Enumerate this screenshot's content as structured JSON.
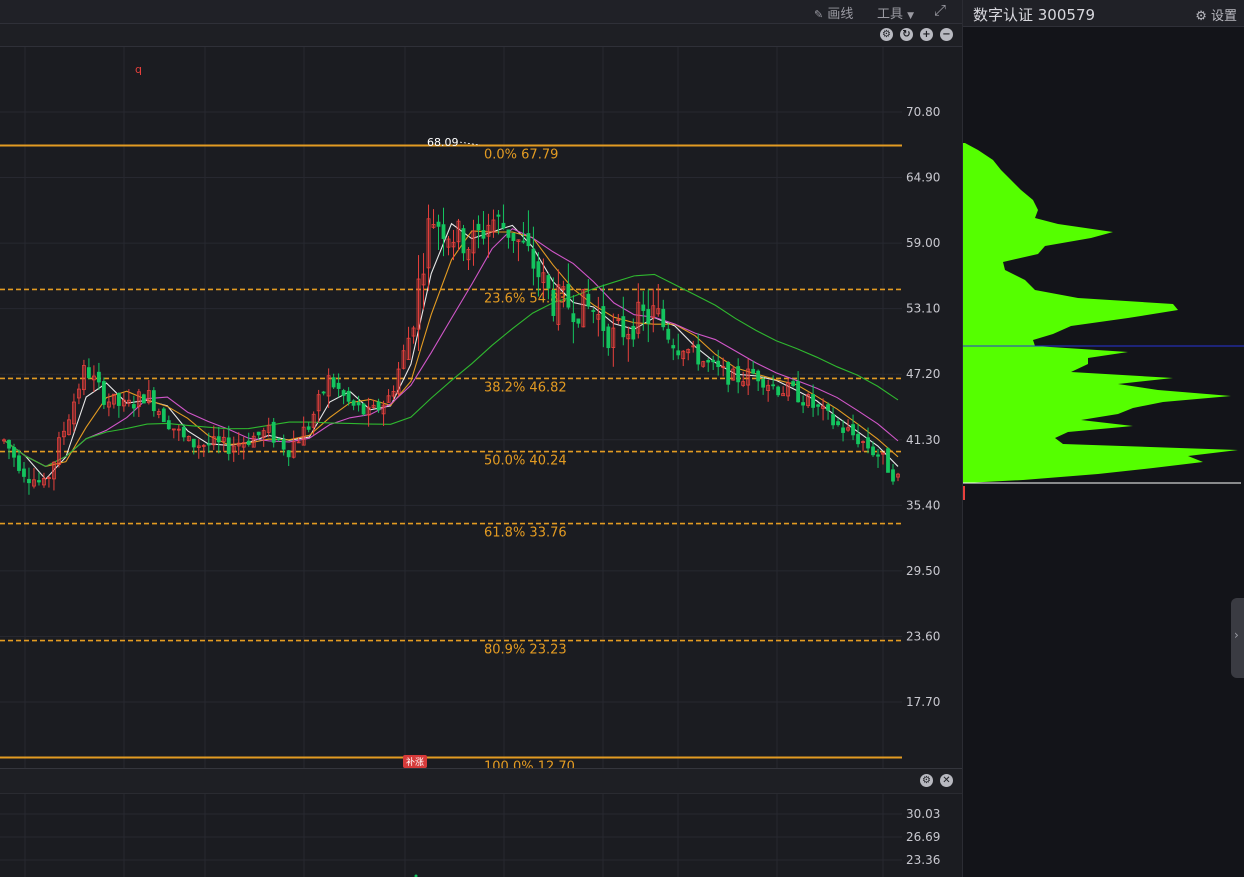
{
  "toolbar": {
    "draw_label": "画线",
    "tools_label": "工具",
    "chart_icons": [
      "gear-icon",
      "refresh-icon",
      "zoom-in-icon",
      "zoom-out-icon"
    ],
    "marker_q": "q",
    "event_badge": "补涨"
  },
  "price_axis": {
    "ticks": [
      "70.80",
      "64.90",
      "59.00",
      "53.10",
      "47.20",
      "41.30",
      "35.40",
      "29.50",
      "23.60",
      "17.70"
    ]
  },
  "fib": {
    "high_label": "68.09",
    "levels": [
      {
        "label": "0.0%  67.79",
        "value": 67.79,
        "style": "solid"
      },
      {
        "label": "23.6%  54.83",
        "value": 54.83,
        "style": "dashed"
      },
      {
        "label": "38.2%  46.82",
        "value": 46.82,
        "style": "dashed"
      },
      {
        "label": "50.0%  40.24",
        "value": 40.24,
        "style": "dashed"
      },
      {
        "label": "61.8%  33.76",
        "value": 33.76,
        "style": "dashed"
      },
      {
        "label": "80.9%  23.23",
        "value": 23.23,
        "style": "dashed"
      },
      {
        "label": "100.0%  12.70",
        "value": 12.7,
        "style": "solid"
      }
    ]
  },
  "sub_axis": {
    "ticks": [
      "30.03",
      "26.69",
      "23.36"
    ]
  },
  "right_panel": {
    "title": "数字认证 300579",
    "settings_label": "设置"
  },
  "colors": {
    "up": "#e8403c",
    "down": "#14c45f",
    "fib": "#e39b22",
    "ma5": "#e8e8e8",
    "ma10": "#e39b22",
    "ma20": "#d056c8",
    "ma60": "#2fb82f",
    "volume_profile": "#55ff00",
    "poc_line": "#2734d8"
  },
  "chart_data": {
    "type": "candlestick",
    "title": "",
    "ylim": [
      12.0,
      75.0
    ],
    "fib_retracement": {
      "high": 67.79,
      "low": 12.7
    },
    "price_range": {
      "low_min": 35.4,
      "high_max": 68.09,
      "last_close": 37.4
    },
    "series_trend": [
      {
        "name": "close",
        "values": [
          41.2,
          38.5,
          37.0,
          42.5,
          47.8,
          45.0,
          44.2,
          45.5,
          43.2,
          41.0,
          40.9,
          40.7,
          41.4,
          42.0,
          40.5,
          42.6,
          46.8,
          44.5,
          43.5,
          45.2,
          51.0,
          61.5,
          60.0,
          58.8,
          61.2,
          60.0,
          57.3,
          53.8,
          53.5,
          53.0,
          50.5,
          52.0,
          52.6,
          50.5,
          48.9,
          47.6,
          46.8,
          47.3,
          46.0,
          45.5,
          44.1,
          42.6,
          41.5,
          40.0,
          37.8
        ]
      }
    ]
  }
}
